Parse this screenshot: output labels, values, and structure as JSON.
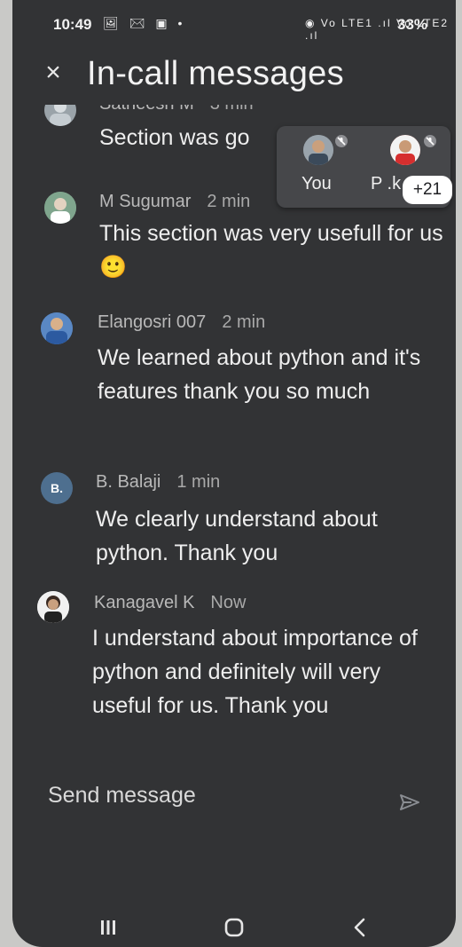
{
  "status_bar": {
    "time": "10:49",
    "left_icons": "🖼 ✉ ▣ •",
    "right_icons": "◉ Vo LTE1 .ıl Vo LTE2 .ıl",
    "battery": "33%"
  },
  "header": {
    "title": "In-call messages",
    "close_icon": "close-icon"
  },
  "participants_panel": {
    "participants": [
      {
        "label": "You"
      },
      {
        "label": "P .k"
      }
    ],
    "more_count": "+21"
  },
  "messages": [
    {
      "sender": "Satheesh M",
      "time": "3 min",
      "text": "Section was go"
    },
    {
      "sender": "M Sugumar",
      "time": "2 min",
      "text": "This section was very usefull for us🙂"
    },
    {
      "sender": "Elangosri 007",
      "time": "2 min",
      "text": "We learned about python and it's features thank you so much"
    },
    {
      "sender": "B. Balaji",
      "time": "1 min",
      "text": "We clearly understand about python. Thank you",
      "initial": "B."
    },
    {
      "sender": "Kanagavel K",
      "time": "Now",
      "text": "I understand about importance of python and definitely will very useful for us. Thank you"
    }
  ],
  "composer": {
    "placeholder": "Send message",
    "send_icon": "send-icon"
  },
  "nav_bar": {
    "buttons": [
      "recents-icon",
      "home-icon",
      "back-icon"
    ]
  },
  "colors": {
    "background": "#323335",
    "text": "#eeeeee",
    "muted": "#b9b9b9",
    "badge_bg": "#ffffff"
  }
}
